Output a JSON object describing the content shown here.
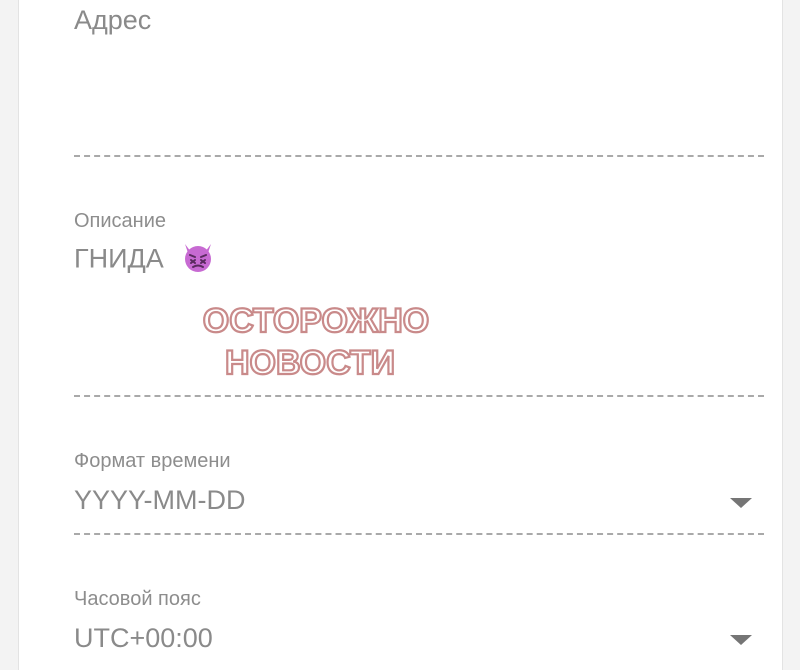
{
  "address": {
    "label": "Адрес",
    "value": ""
  },
  "description": {
    "label": "Описание",
    "value": "ГНИДА",
    "emoji_icon": "angry-devil-face-icon"
  },
  "watermark": {
    "line1": "ОСТОРОЖНО",
    "line2": "НОВОСТИ",
    "color": "#c98a8a"
  },
  "time_format": {
    "label": "Формат времени",
    "selected": "YYYY-MM-DD",
    "icon": "dropdown-arrow-icon"
  },
  "timezone": {
    "label": "Часовой пояс",
    "selected": "UTC+00:00",
    "icon": "dropdown-arrow-icon"
  }
}
